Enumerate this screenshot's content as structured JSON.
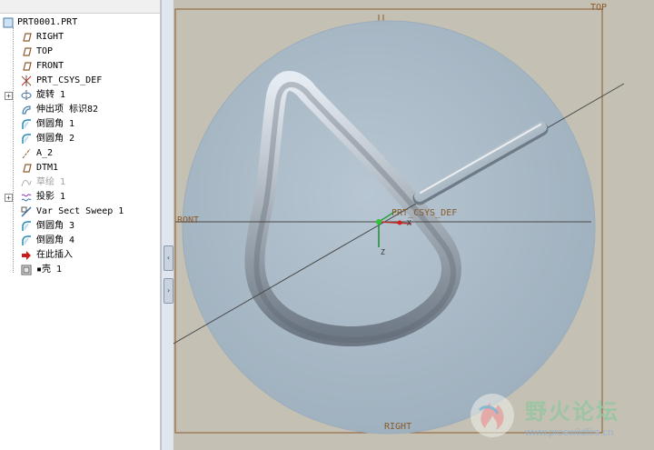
{
  "tree": {
    "root": "PRT0001.PRT",
    "items": [
      {
        "label": "RIGHT",
        "icon": "datum-plane-icon",
        "expandable": false,
        "dim": false
      },
      {
        "label": "TOP",
        "icon": "datum-plane-icon",
        "expandable": false,
        "dim": false
      },
      {
        "label": "FRONT",
        "icon": "datum-plane-icon",
        "expandable": false,
        "dim": false
      },
      {
        "label": "PRT_CSYS_DEF",
        "icon": "csys-icon",
        "expandable": false,
        "dim": false
      },
      {
        "label": "旋转 1",
        "icon": "revolve-icon",
        "expandable": true,
        "dim": false
      },
      {
        "label": "伸出项 标识82",
        "icon": "protrusion-icon",
        "expandable": false,
        "dim": false
      },
      {
        "label": "倒圆角 1",
        "icon": "round-icon",
        "expandable": false,
        "dim": false
      },
      {
        "label": "倒圆角 2",
        "icon": "round-icon",
        "expandable": false,
        "dim": false
      },
      {
        "label": "A_2",
        "icon": "datum-axis-icon",
        "expandable": false,
        "dim": false
      },
      {
        "label": "DTM1",
        "icon": "datum-plane-icon",
        "expandable": false,
        "dim": false
      },
      {
        "label": "草绘 1",
        "icon": "sketch-icon",
        "expandable": false,
        "dim": true
      },
      {
        "label": "投影 1",
        "icon": "projection-icon",
        "expandable": true,
        "dim": false
      },
      {
        "label": "Var Sect Sweep 1",
        "icon": "sweep-icon",
        "expandable": false,
        "dim": false
      },
      {
        "label": "倒圆角 3",
        "icon": "round-icon",
        "expandable": false,
        "dim": false
      },
      {
        "label": "倒圆角 4",
        "icon": "round-icon",
        "expandable": false,
        "dim": false
      },
      {
        "label": "在此插入",
        "icon": "insert-arrow-icon",
        "expandable": false,
        "dim": false
      },
      {
        "label": "▪壳 1",
        "icon": "shell-icon",
        "expandable": false,
        "dim": false
      }
    ]
  },
  "viewport": {
    "labels": {
      "top": "TOP",
      "front": "RONT",
      "right": "RIGHT",
      "csys": "PRT_CSYS_DEF",
      "axis_x": "X",
      "axis_z": "Z"
    }
  },
  "watermark": {
    "text": "野火论坛",
    "url": "www.proewildfire.cn"
  },
  "colors": {
    "viewport_bg": "#c4c1b4",
    "part": "#a9b9c6",
    "datum": "#8b5a2b"
  }
}
